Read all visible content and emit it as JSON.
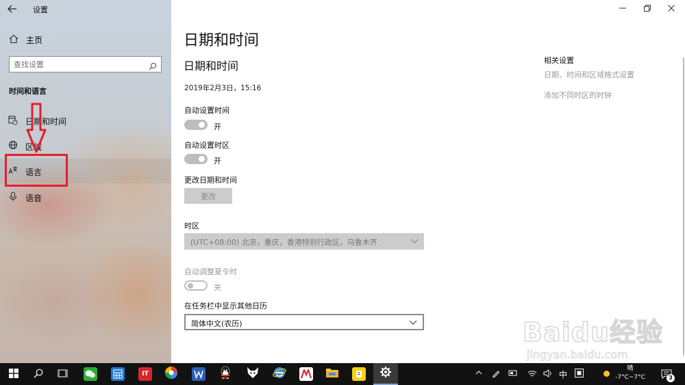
{
  "window": {
    "title": "设置",
    "back_icon": "back-arrow-icon",
    "minimize_icon": "minimize-icon",
    "restore_icon": "restore-icon",
    "close_icon": "close-icon"
  },
  "sidebar": {
    "home_label": "主页",
    "search_placeholder": "查找设置",
    "section_title": "时间和语言",
    "items": [
      {
        "label": "日期和时间",
        "icon": "calendar-clock-icon"
      },
      {
        "label": "区域",
        "icon": "globe-icon"
      },
      {
        "label": "语言",
        "icon": "language-icon"
      },
      {
        "label": "语音",
        "icon": "microphone-icon"
      }
    ]
  },
  "main": {
    "page_title": "日期和时间",
    "section_title": "日期和时间",
    "current_datetime": "2019年2月3日，15:16",
    "auto_time_label": "自动设置时间",
    "auto_time_state": "开",
    "auto_timezone_label": "自动设置时区",
    "auto_timezone_state": "开",
    "change_label": "更改日期和时间",
    "change_button": "更改",
    "timezone_label": "时区",
    "timezone_value": "(UTC+08:00) 北京，重庆，香港特别行政区，乌鲁木齐",
    "dst_label": "自动调整夏令时",
    "dst_state": "关",
    "calendar_label": "在任务栏中显示其他日历",
    "calendar_value": "简体中文(农历)"
  },
  "related": {
    "title": "相关设置",
    "links": [
      "日期、时间和区域格式设置",
      "添加不同时区的时钟"
    ]
  },
  "watermark": {
    "logo": "Baidu经验",
    "url": "jingyan.baidu.com"
  },
  "taskbar": {
    "ime": "中",
    "weather_condition": "晴",
    "weather_temp": "-7°C~7°C",
    "notification_count": "3",
    "apps": [
      "start-icon",
      "search-icon",
      "task-view-icon",
      "wechat-icon",
      "calculator-app-icon",
      "it-app-icon",
      "color-wheel-app-icon",
      "word-app-icon",
      "qq-penguin-icon",
      "fox-app-icon",
      "ie-browser-icon",
      "red-app-icon",
      "file-explorer-icon",
      "note-app-icon",
      "settings-gear-icon"
    ]
  },
  "colors": {
    "annotation_red": "#e21f2b",
    "taskbar_bg": "#121212",
    "link_gray": "#9a9a9a"
  }
}
